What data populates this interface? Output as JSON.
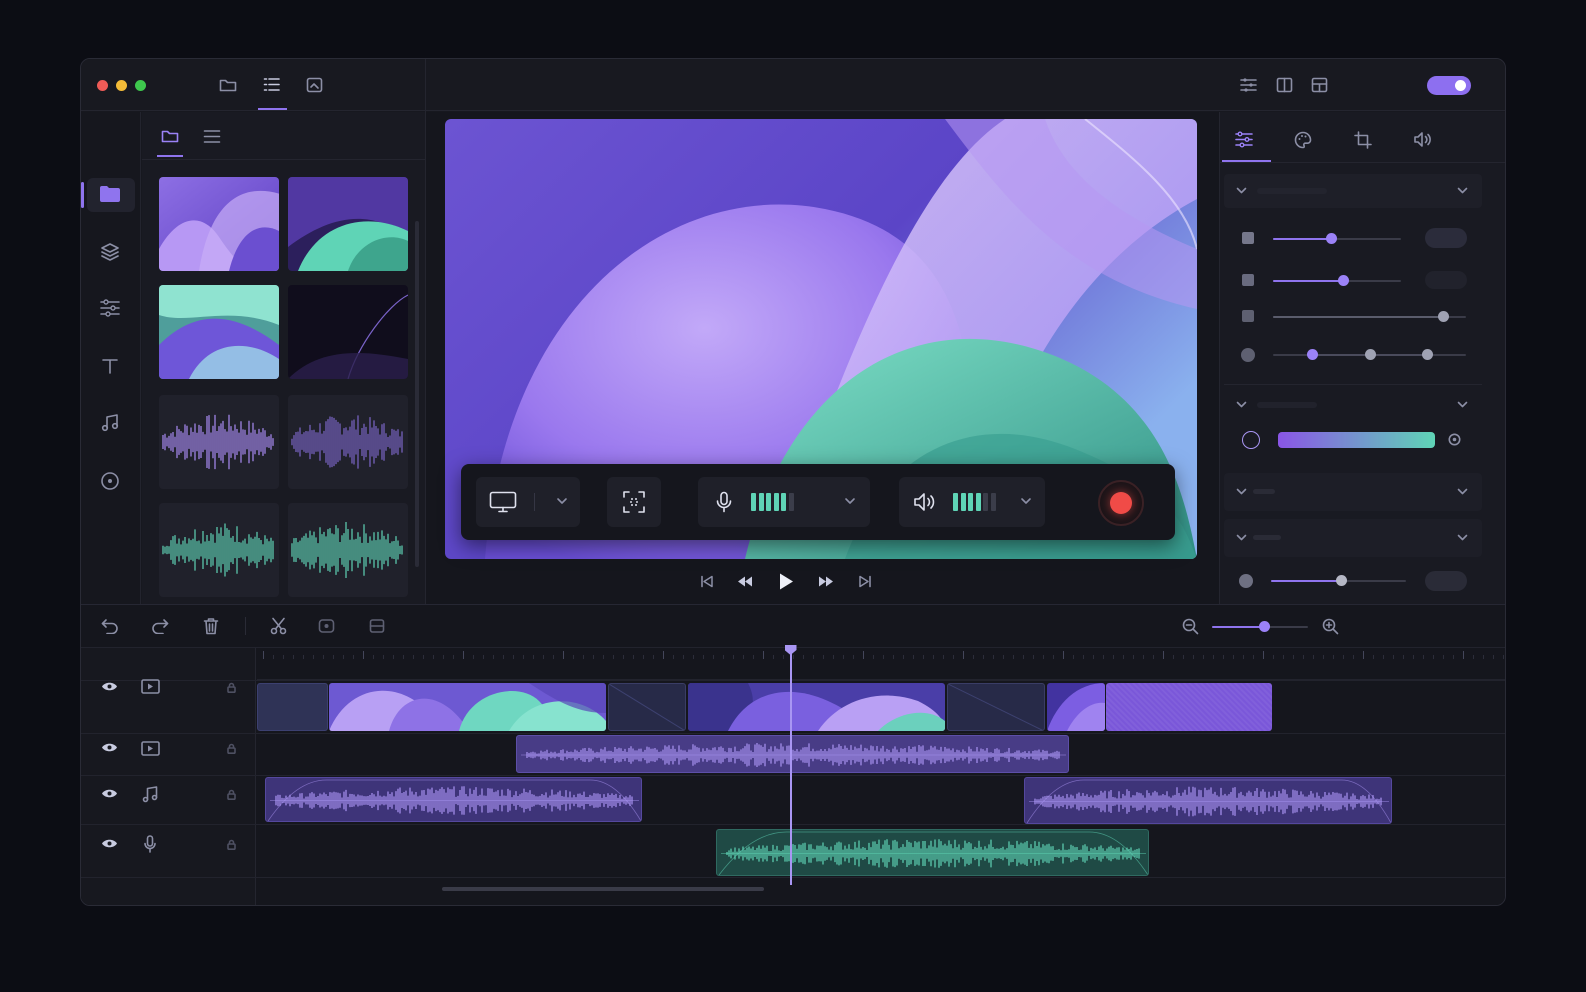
{
  "app": {
    "window_controls": [
      "close",
      "minimize",
      "maximize"
    ],
    "accent": "#8f74ee",
    "teal": "#5fd4b6",
    "record_color": "#f04b47"
  },
  "toolbar": {
    "left_icons": [
      "folder-icon",
      "list-icon",
      "image-icon"
    ],
    "active_left": "list-icon",
    "right_icons": [
      "sliders-icon",
      "columns-icon",
      "layout-icon"
    ],
    "toggle_on": true
  },
  "sidebar": {
    "items": [
      "media-icon",
      "layers-icon",
      "adjust-icon",
      "text-icon",
      "music-icon",
      "sticker-icon"
    ],
    "active": "media-icon"
  },
  "media_panel": {
    "tabs": [
      "folder-icon",
      "list-icon"
    ],
    "active_tab": "folder-icon",
    "items": [
      {
        "kind": "image",
        "palette": "purple"
      },
      {
        "kind": "image",
        "palette": "purple-teal"
      },
      {
        "kind": "image",
        "palette": "teal"
      },
      {
        "kind": "image",
        "palette": "dark"
      },
      {
        "kind": "audio",
        "color": "purple"
      },
      {
        "kind": "audio",
        "color": "purple"
      },
      {
        "kind": "audio",
        "color": "teal"
      },
      {
        "kind": "audio",
        "color": "teal"
      }
    ]
  },
  "recorder": {
    "source_icon": "monitor-icon",
    "region_icon": "region-select-icon",
    "mic_icon": "microphone-icon",
    "mic_level": 0.75,
    "speaker_icon": "speaker-icon",
    "speaker_level": 0.6,
    "record_button": "record-button"
  },
  "transport": {
    "buttons": [
      "skip-start-icon",
      "rewind-icon",
      "play-icon",
      "fast-forward-icon",
      "skip-end-icon"
    ]
  },
  "inspector": {
    "tabs": [
      "adjust-icon",
      "palette-icon",
      "crop-icon",
      "volume-icon"
    ],
    "active_tab": "adjust-icon",
    "section1_sliders": [
      0.45,
      0.55,
      0.88
    ],
    "multi_slider": [
      0.2,
      0.5,
      0.8
    ],
    "gradient": {
      "from": "#8a55e6",
      "to": "#5fd4b6"
    },
    "bottom_slider": 0.52
  },
  "timeline": {
    "tools": [
      "undo-icon",
      "redo-icon",
      "trash-icon",
      "scissors-icon",
      "freeze-icon",
      "split-icon"
    ],
    "zoom_level": 0.54,
    "playhead_fraction": 0.426,
    "tracks": [
      {
        "type": "video",
        "icon": "video-track-icon"
      },
      {
        "type": "video",
        "icon": "video-track-icon"
      },
      {
        "type": "music",
        "icon": "music-note-icon"
      },
      {
        "type": "voice",
        "icon": "microphone-icon"
      }
    ]
  }
}
